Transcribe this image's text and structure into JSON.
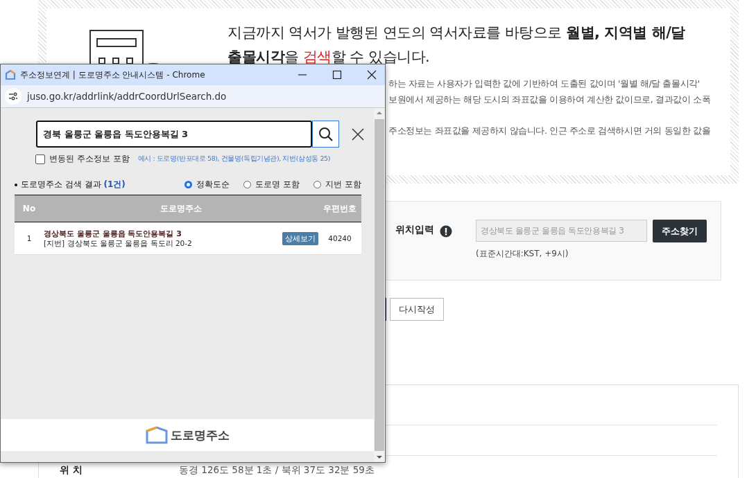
{
  "intro": {
    "heading": "지금까지 역서가 발행된 연도의 역서자료를 바탕으로 **월별, 지역별 해/달**",
    "heading_line2": [
      "**출몰시각**을 ",
      "검색",
      "할 수 있습니다."
    ],
    "paragraph": [
      "하는 자료는 사용자가 입력한 값에 기반하여 도출된 값이며 '월별 해/달 출몰시각'",
      "보원에서 제공하는 해당 도시의 좌표값을 이용하여 계산한 값이므로, 결과값이 소폭",
      "주소정보는 좌표값을 제공하지 않습니다. 인근 주소로 검색하시면 거의 동일한 값을"
    ]
  },
  "location": {
    "label": "위치입력",
    "value": "경상북도 울릉군 울릉읍 독도안용복길 3",
    "button": "주소찾기",
    "note": "(표준시간대:KST, +9시)"
  },
  "actions": {
    "reset": "다시작성"
  },
  "result": {
    "label": "위 치",
    "value": "동경 126도 58분 1초 / 북위 37도 32분 59초"
  },
  "popup": {
    "title": "주소정보연계 | 도로명주소 안내시스템 - Chrome",
    "url": "juso.go.kr/addrlink/addrCoordUrlSearch.do",
    "search_value": "경북 울릉군 울릉읍 독도안용복길 3",
    "include_changed": {
      "label": "변동된 주소정보 포함",
      "checked": false
    },
    "example": "예시 : 도로명(반포대로 58), 건물명(독립기념관), 지번(삼성동 25)",
    "results_title": "도로명주소 검색 결과",
    "results_count": "(1건)",
    "sort_options": [
      {
        "label": "정확도순",
        "selected": true
      },
      {
        "label": "도로명 포함",
        "selected": false
      },
      {
        "label": "지번 포함",
        "selected": false
      }
    ],
    "columns": [
      "No",
      "도로명주소",
      "우편번호"
    ],
    "rows": [
      {
        "no": "1",
        "road": "경상북도 울릉군 울릉읍 독도안용복길 3",
        "jibun": "[지번] 경상북도 울릉군 울릉읍 독도리 20-2",
        "detail": "상세보기",
        "zip": "40240"
      }
    ],
    "footer_logo": "도로명주소"
  }
}
